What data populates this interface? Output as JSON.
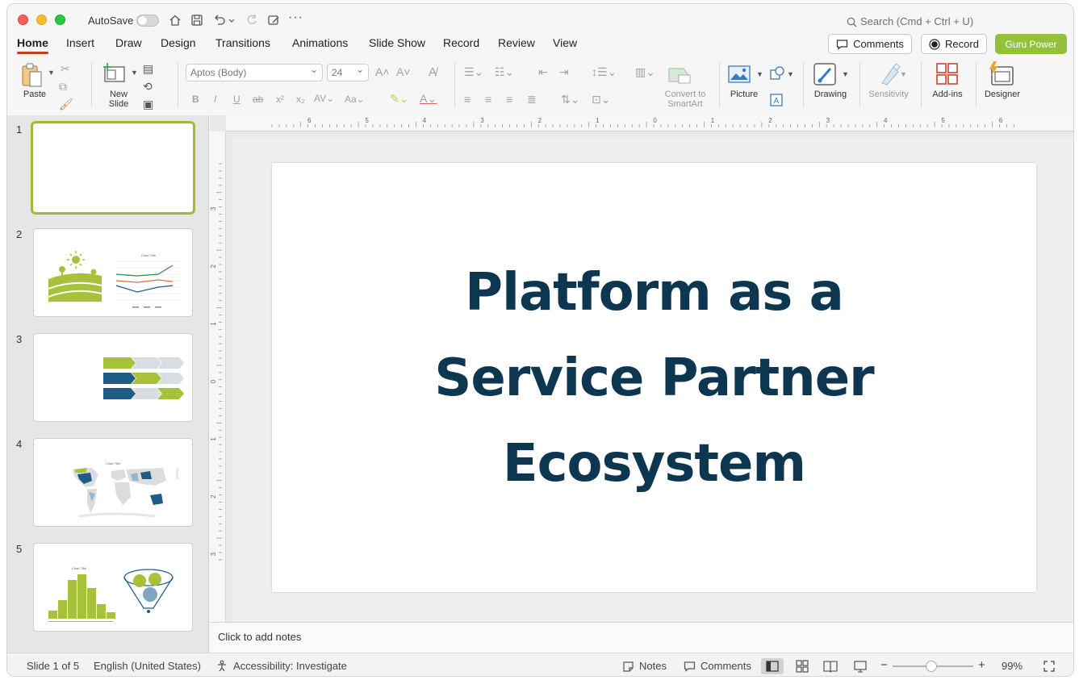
{
  "titlebar": {
    "autosave_label": "AutoSave",
    "search_placeholder": "Search (Cmd + Ctrl + U)"
  },
  "tabs": [
    {
      "label": "Home",
      "active": true
    },
    {
      "label": "Insert"
    },
    {
      "label": "Draw"
    },
    {
      "label": "Design"
    },
    {
      "label": "Transitions"
    },
    {
      "label": "Animations"
    },
    {
      "label": "Slide Show"
    },
    {
      "label": "Record"
    },
    {
      "label": "Review"
    },
    {
      "label": "View"
    }
  ],
  "header_buttons": {
    "comments": "Comments",
    "record": "Record",
    "guru": "Guru Power"
  },
  "ribbon": {
    "paste": "Paste",
    "new_slide": "New\nSlide",
    "font_name": "Aptos (Body)",
    "font_size": "24",
    "convert_smartart": "Convert to\nSmartArt",
    "picture": "Picture",
    "drawing": "Drawing",
    "sensitivity": "Sensitivity",
    "add_ins": "Add-ins",
    "designer": "Designer"
  },
  "slides": [
    {
      "number": "1"
    },
    {
      "number": "2",
      "chart_title": "Chart Title"
    },
    {
      "number": "3"
    },
    {
      "number": "4",
      "chart_title": "Chart Title"
    },
    {
      "number": "5",
      "chart_title": "Chart Title"
    }
  ],
  "slide": {
    "title_line1": "Platform as a",
    "title_line2": "Service Partner",
    "title_line3": "Ecosystem"
  },
  "ruler": {
    "h_labels": [
      "6",
      "5",
      "4",
      "3",
      "2",
      "1",
      "0",
      "1",
      "2",
      "3",
      "4",
      "5",
      "6"
    ],
    "v_labels": [
      "3",
      "2",
      "1",
      "0",
      "1",
      "2",
      "3"
    ]
  },
  "notes": {
    "placeholder": "Click to add notes"
  },
  "status": {
    "slide_count": "Slide 1 of 5",
    "language": "English (United States)",
    "accessibility": "Accessibility: Investigate",
    "notes": "Notes",
    "comments": "Comments",
    "zoom": "99%"
  },
  "colors": {
    "accent": "#c43e1c",
    "guru": "#92c13c",
    "title_text": "#0d3650",
    "thumb_green": "#a8c13a",
    "thumb_blue": "#1f5c85"
  }
}
